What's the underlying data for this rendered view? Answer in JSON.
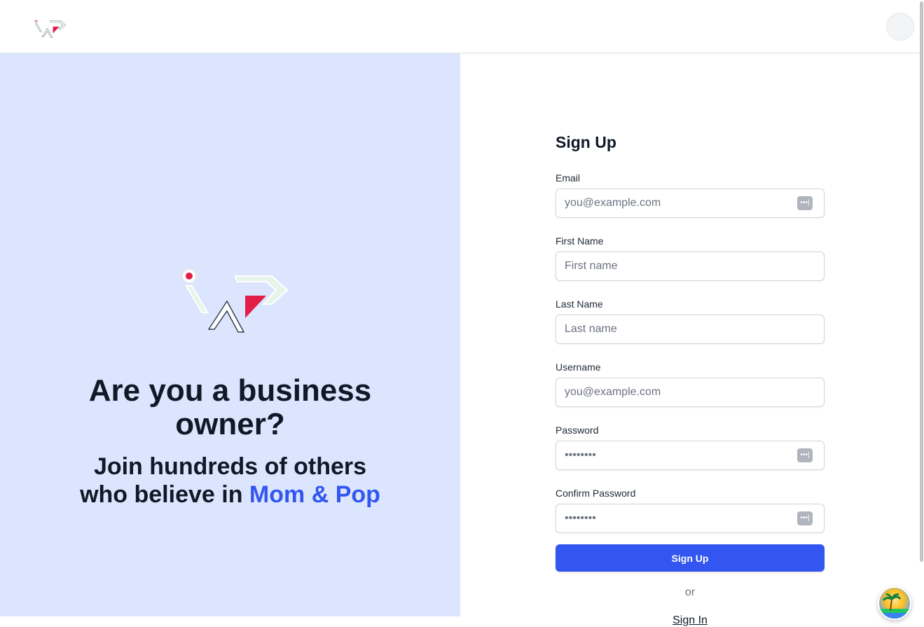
{
  "header": {
    "logo": "map-logo",
    "avatar": "user-avatar"
  },
  "hero": {
    "logo": "map-logo",
    "headline_line1": "Are you a business",
    "headline_line2": "owner?",
    "sub_line1": "Join hundreds of others",
    "sub_line2_prefix": "who believe in ",
    "sub_line2_brand": "Mom & Pop",
    "brand_color": "#3355f0"
  },
  "form": {
    "title": "Sign Up",
    "email": {
      "label": "Email",
      "placeholder": "you@example.com"
    },
    "first_name": {
      "label": "First Name",
      "placeholder": "First name"
    },
    "last_name": {
      "label": "Last Name",
      "placeholder": "Last name"
    },
    "username": {
      "label": "Username",
      "placeholder": "you@example.com"
    },
    "password": {
      "label": "Password",
      "placeholder": "••••••••"
    },
    "confirm_password": {
      "label": "Confirm Password",
      "placeholder": "••••••••"
    },
    "submit_label": "Sign Up",
    "or_text": "or",
    "signin_label": "Sign In"
  },
  "colors": {
    "left_panel_bg": "#dbe6fe",
    "primary": "#3355f0"
  },
  "icons": {
    "password_manager": "password-manager-icon",
    "floating_button": "beach-avatar-icon"
  }
}
